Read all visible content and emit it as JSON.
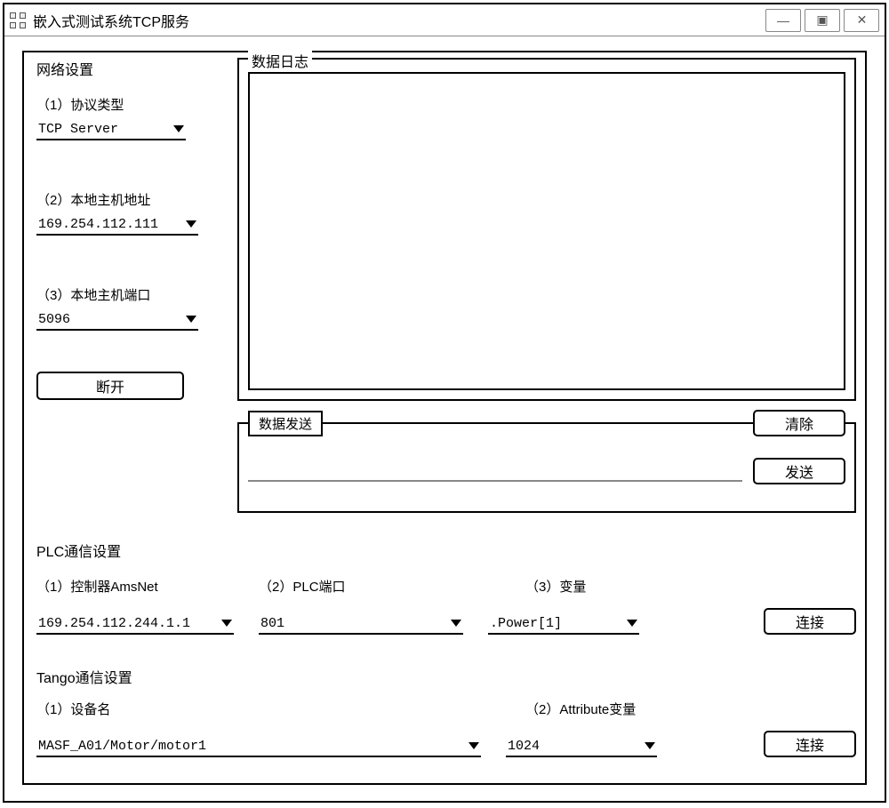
{
  "window_title": "嵌入式测试系统TCP服务",
  "win_buttons": {
    "minimize_glyph": "—",
    "maximize_glyph": "▣",
    "close_glyph": "✕"
  },
  "network": {
    "group_title": "网络设置",
    "protocol_label": "（1）协议类型",
    "protocol_value": "TCP Server",
    "host_label": "（2）本地主机地址",
    "host_value": "169.254.112.111",
    "port_label": "（3）本地主机端口",
    "port_value": "5096",
    "disconnect_label": "断开"
  },
  "log": {
    "title": "数据日志"
  },
  "send": {
    "title": "数据发送",
    "clear_label": "清除",
    "send_label": "发送",
    "input_value": ""
  },
  "plc": {
    "group_title": "PLC通信设置",
    "amsnet_label": "（1）控制器AmsNet",
    "amsnet_value": "169.254.112.244.1.1",
    "port_label": "（2）PLC端口",
    "port_value": "801",
    "var_label": "（3）变量",
    "var_value": ".Power[1]",
    "connect_label": "连接"
  },
  "tango": {
    "group_title": "Tango通信设置",
    "device_label": "（1）设备名",
    "device_value": "MASF_A01/Motor/motor1",
    "attr_label": "（2）Attribute变量",
    "attr_value": "1024",
    "connect_label": "连接"
  }
}
